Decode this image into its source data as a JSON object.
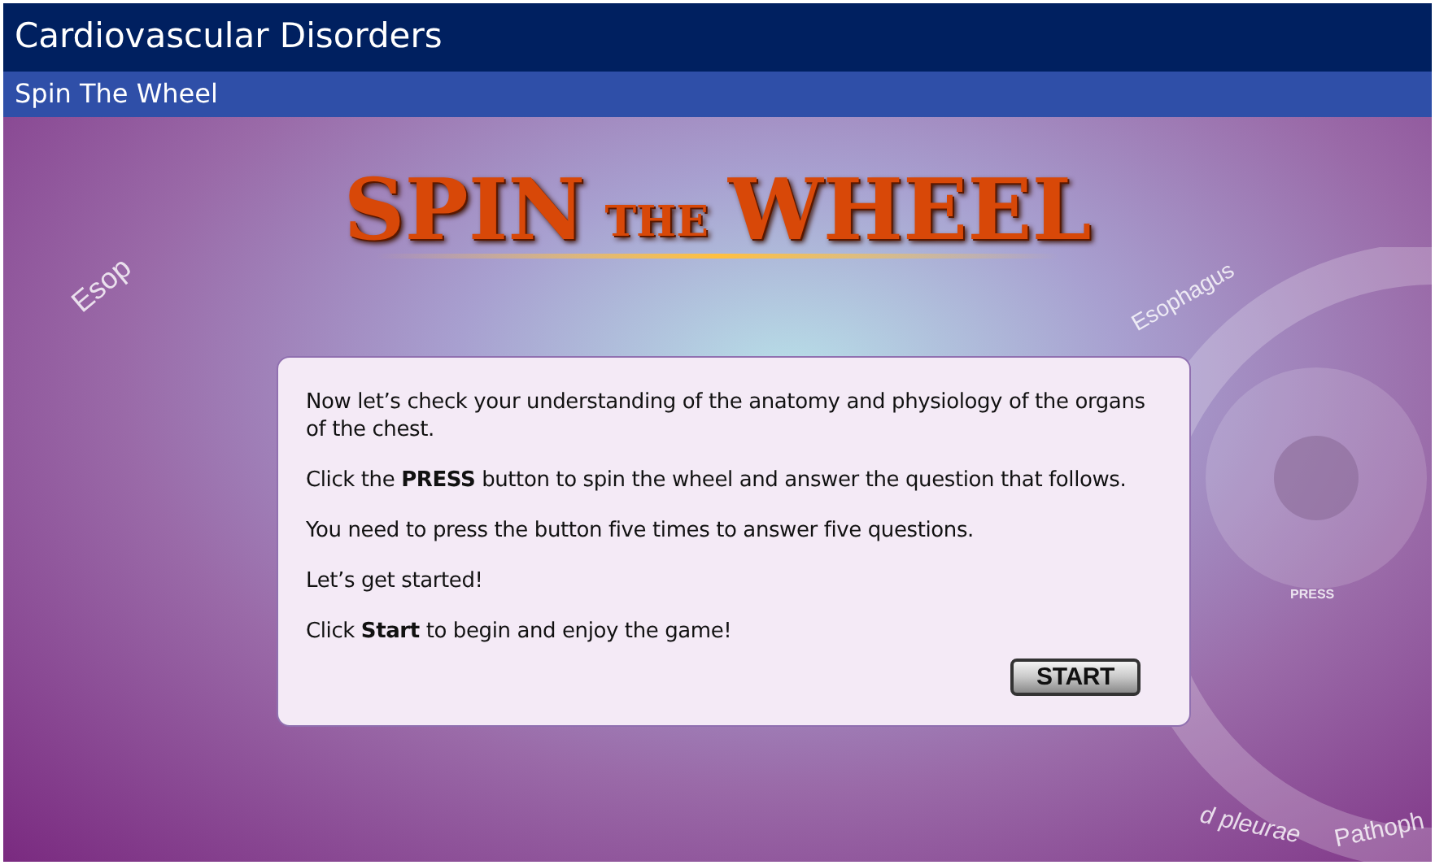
{
  "window": {
    "title": "Cardiovascular Disorders"
  },
  "section": {
    "title": "Spin The Wheel"
  },
  "logo": {
    "word_1": "SPIN",
    "word_2": "THE",
    "word_3": "WHEEL"
  },
  "wheel_labels": [
    "Esop",
    "Esophagus",
    "PRESS",
    "d pleurae",
    "Pathoph"
  ],
  "intro": {
    "paragraphs": [
      "Now let’s check your understanding of the anatomy and physiology of the organs of the chest.",
      "Click the **PRESS** button to spin the wheel and answer the question that follows.",
      "You need to press the button five times to answer five questions.",
      "Let’s get started!",
      "Click **Start** to begin and enjoy the game!"
    ],
    "button": "START"
  }
}
